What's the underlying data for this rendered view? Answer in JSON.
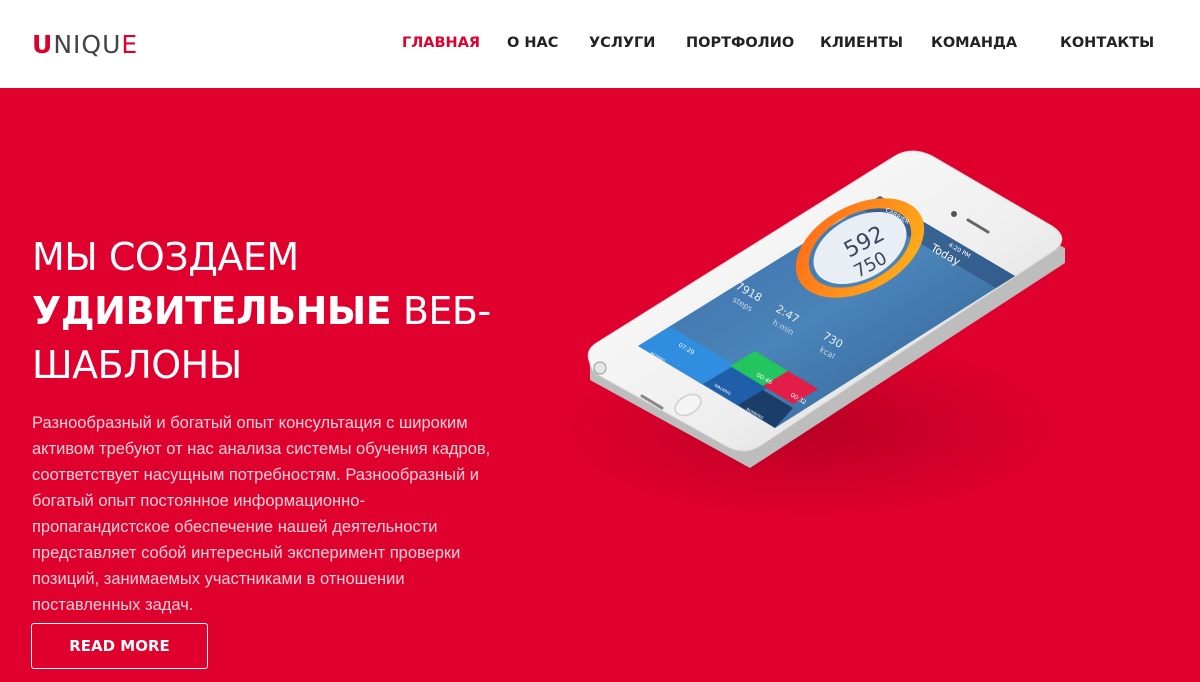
{
  "header": {
    "logo": {
      "first": "U",
      "middle": "NIQU",
      "last": "E"
    },
    "nav": [
      {
        "label": "ГЛАВНАЯ",
        "active": true
      },
      {
        "label": "О НАС",
        "active": false
      },
      {
        "label": "УСЛУГИ",
        "active": false
      },
      {
        "label": "ПОРТФОЛИО",
        "active": false
      },
      {
        "label": "КЛИЕНТЫ",
        "active": false
      },
      {
        "label": "КОМАНДА",
        "active": false
      },
      {
        "label": "КОНТАКТЫ",
        "active": false
      }
    ]
  },
  "hero": {
    "title_line1": "МЫ СОЗДАЕМ",
    "title_bold": "УДИВИТЕЛЬНЫЕ",
    "title_line2_rest": " ВЕБ-",
    "title_line3": "ШАБЛОНЫ",
    "text": "Разнообразный и богатый опыт консультация с широким активом требуют от нас анализа системы обучения кадров, соответствует насущным потребностям. Разнообразный и богатый опыт постоянное информационно-пропагандистское обеспечение нашей деятельности представляет собой интересный эксперимент проверки позиций, занимаемых участниками в отношении поставленных задач.",
    "button": "READ MORE"
  },
  "phone": {
    "status_carrier": "CARRIER",
    "status_time": "4:20 PM",
    "screen_title": "Today",
    "ring_value": "592",
    "ring_goal": "750",
    "stat1_value": "7918",
    "stat1_label": "steps",
    "stat2_value": "2:47",
    "stat2_label": "h:min",
    "stat3_value": "730",
    "stat3_label": "kcal",
    "bar1_time": "07:29",
    "bar1_label": "MOVING",
    "bar2_time": "00:46",
    "bar2_label": "WALKING",
    "bar3_time": "00:32",
    "bar3_label": "RUNNING"
  },
  "colors": {
    "accent": "#e0002d",
    "text_dark": "#222222",
    "white": "#ffffff"
  }
}
